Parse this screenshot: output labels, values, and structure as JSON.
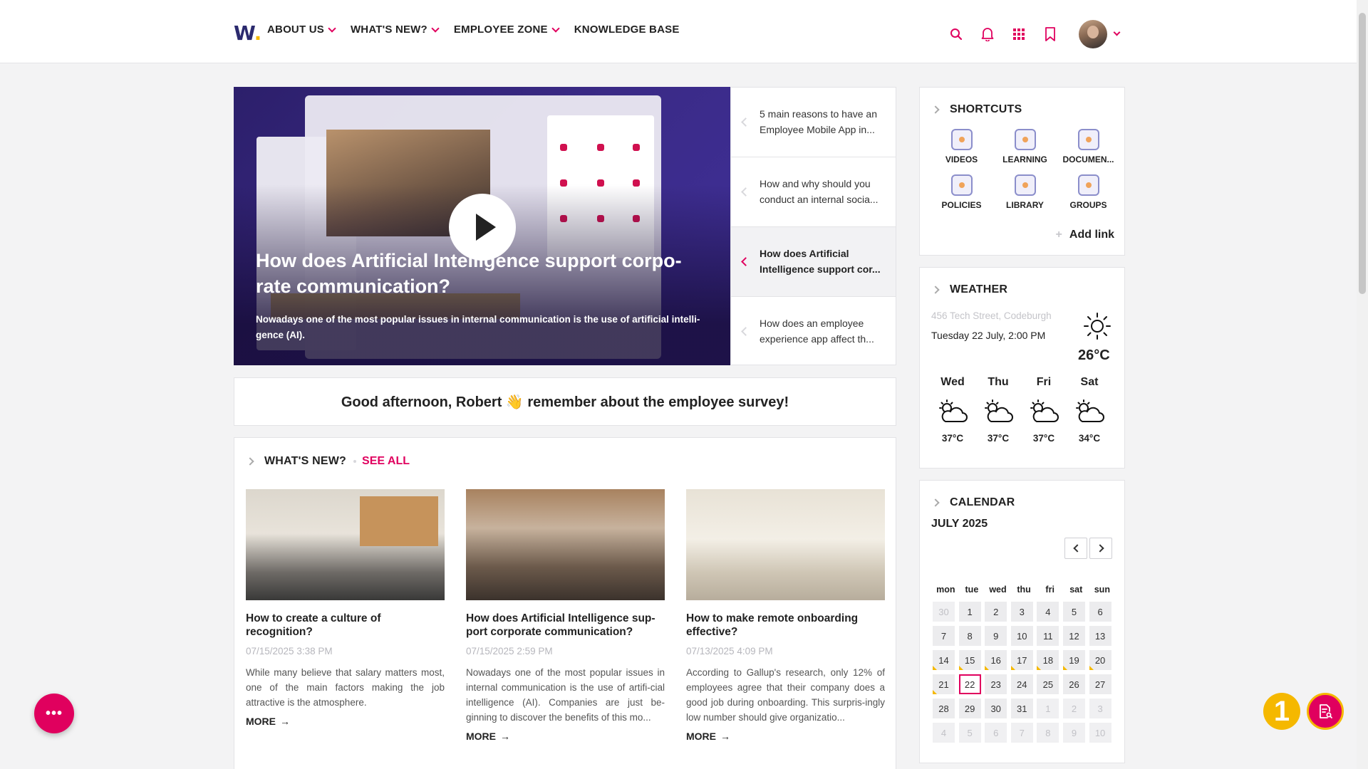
{
  "header": {
    "logo": "W",
    "nav": [
      {
        "label": "ABOUT US",
        "dropdown": true
      },
      {
        "label": "WHAT'S NEW?",
        "dropdown": true
      },
      {
        "label": "EMPLOYEE ZONE",
        "dropdown": true
      },
      {
        "label": "KNOWLEDGE BASE",
        "dropdown": false
      }
    ],
    "icons": [
      "search-icon",
      "bell-icon",
      "apps-grid-icon",
      "bookmark-icon"
    ],
    "accent_color": "#e0005e"
  },
  "hero": {
    "title": "How does Artificial Intelligence support corpo-rate communication?",
    "description": "Nowadays one of the most popular issues in internal communication is the use of artificial intelli-gence (AI).",
    "list": [
      {
        "text": "5 main reasons to have an Employee Mobile App in...",
        "active": false
      },
      {
        "text": "How and why should you conduct an internal socia...",
        "active": false
      },
      {
        "text": "How does Artificial Intelligence support cor...",
        "active": true
      },
      {
        "text": "How does an employee experience app affect th...",
        "active": false
      }
    ]
  },
  "greeting": {
    "text": "Good afternoon, Robert 👋 remember about the employee survey!"
  },
  "news": {
    "title": "WHAT'S NEW?",
    "see_all": "SEE ALL",
    "cards": [
      {
        "title": "How to create a culture of recognition?",
        "date": "07/15/2025 3:38 PM",
        "desc": "While many believe that salary matters most, one of the main factors making the job attractive is the atmosphere.",
        "more": "MORE"
      },
      {
        "title": "How does Artificial Intelligence sup-port corporate communication?",
        "date": "07/15/2025 2:59 PM",
        "desc": "Nowadays one of the most popular issues in internal communication is the use of artifi-cial intelligence (AI). Companies are just be-ginning to discover the benefits of this mo...",
        "more": "MORE"
      },
      {
        "title": "How to make remote onboarding effective?",
        "date": "07/13/2025 4:09 PM",
        "desc": "According to Gallup's research, only 12% of employees agree that their company does a good job during onboarding. This surpris-ingly low number should give organizatio...",
        "more": "MORE"
      }
    ]
  },
  "shortcuts": {
    "title": "SHORTCUTS",
    "items": [
      {
        "label": "VIDEOS",
        "icon": "videos-icon"
      },
      {
        "label": "LEARNING",
        "icon": "learning-icon"
      },
      {
        "label": "DOCUMEN...",
        "icon": "documents-icon"
      },
      {
        "label": "POLICIES",
        "icon": "policies-icon"
      },
      {
        "label": "LIBRARY",
        "icon": "library-icon"
      },
      {
        "label": "GROUPS",
        "icon": "groups-icon"
      }
    ],
    "add_link": "Add link"
  },
  "weather": {
    "title": "WEATHER",
    "address": "456 Tech Street, Codeburgh",
    "date": "Tuesday 22 July, 2:00 PM",
    "temp": "26°C",
    "forecast": [
      {
        "day": "Wed",
        "temp": "37°C"
      },
      {
        "day": "Thu",
        "temp": "37°C"
      },
      {
        "day": "Fri",
        "temp": "37°C"
      },
      {
        "day": "Sat",
        "temp": "34°C"
      }
    ]
  },
  "calendar": {
    "title": "CALENDAR",
    "month": "JULY 2025",
    "weekdays": [
      "mon",
      "tue",
      "wed",
      "thu",
      "fri",
      "sat",
      "sun"
    ],
    "days": [
      {
        "d": "30",
        "out": true
      },
      {
        "d": "1"
      },
      {
        "d": "2"
      },
      {
        "d": "3"
      },
      {
        "d": "4"
      },
      {
        "d": "5"
      },
      {
        "d": "6"
      },
      {
        "d": "7"
      },
      {
        "d": "8"
      },
      {
        "d": "9"
      },
      {
        "d": "10"
      },
      {
        "d": "11"
      },
      {
        "d": "12"
      },
      {
        "d": "13"
      },
      {
        "d": "14",
        "ev": true
      },
      {
        "d": "15",
        "ev": true
      },
      {
        "d": "16",
        "ev": true
      },
      {
        "d": "17",
        "ev": true
      },
      {
        "d": "18",
        "ev": true
      },
      {
        "d": "19",
        "ev": true
      },
      {
        "d": "20",
        "ev": true
      },
      {
        "d": "21",
        "ev": true
      },
      {
        "d": "22",
        "today": true
      },
      {
        "d": "23"
      },
      {
        "d": "24"
      },
      {
        "d": "25"
      },
      {
        "d": "26"
      },
      {
        "d": "27"
      },
      {
        "d": "28"
      },
      {
        "d": "29"
      },
      {
        "d": "30"
      },
      {
        "d": "31"
      },
      {
        "d": "1",
        "out": true
      },
      {
        "d": "2",
        "out": true
      },
      {
        "d": "3",
        "out": true
      },
      {
        "d": "4",
        "out": true
      },
      {
        "d": "5",
        "out": true
      },
      {
        "d": "6",
        "out": true
      },
      {
        "d": "7",
        "out": true
      },
      {
        "d": "8",
        "out": true
      },
      {
        "d": "9",
        "out": true
      },
      {
        "d": "10",
        "out": true
      }
    ]
  },
  "floating": {
    "menu_fab": "•••",
    "notification_count": "1"
  }
}
